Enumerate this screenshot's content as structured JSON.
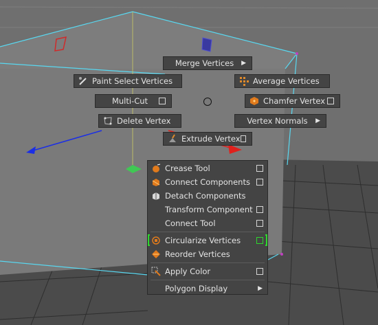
{
  "colors": {
    "menu_bg": "#444444",
    "viewport_bg": "#6f6f6f",
    "wire": "#58d9f2",
    "x_axis": "#e0201c",
    "z_axis": "#1a2ee6"
  },
  "radial": {
    "merge_vertices": "Merge Vertices",
    "paint_select_vertices": "Paint Select Vertices",
    "average_vertices": "Average Vertices",
    "multi_cut": "Multi-Cut",
    "chamfer_vertex": "Chamfer Vertex",
    "delete_vertex": "Delete Vertex",
    "vertex_normals": "Vertex Normals",
    "extrude_vertex": "Extrude Vertex"
  },
  "menu": {
    "crease_tool": "Crease Tool",
    "connect_components": "Connect Components",
    "detach_components": "Detach Components",
    "transform_component": "Transform Component",
    "connect_tool": "Connect Tool",
    "circularize_vertices": "Circularize Vertices",
    "reorder_vertices": "Reorder Vertices",
    "apply_color": "Apply Color",
    "polygon_display": "Polygon Display"
  }
}
